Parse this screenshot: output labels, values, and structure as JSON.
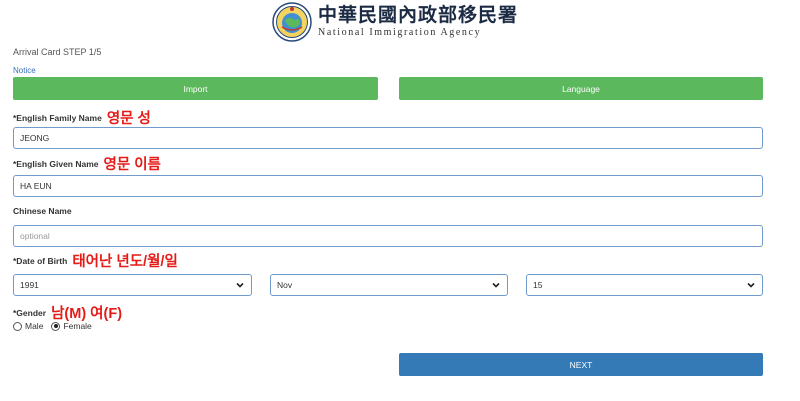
{
  "header": {
    "agency_cn": "中華民國內政部移民署",
    "agency_en": "National Immigration Agency"
  },
  "step_label": "Arrival Card STEP 1/5",
  "notice_link": "Notice",
  "buttons": {
    "import": "Import",
    "language": "Language",
    "next": "NEXT"
  },
  "fields": {
    "family_name": {
      "label": "*English Family Name",
      "annotation_ko": "영문 성",
      "value": "JEONG"
    },
    "given_name": {
      "label": "*English Given Name",
      "annotation_ko": "영문 이름",
      "value": "HA EUN"
    },
    "chinese_name": {
      "label": "Chinese Name",
      "placeholder": "optional",
      "value": ""
    },
    "dob": {
      "label": "*Date of Birth",
      "annotation_ko": "태어난 년도/월/일",
      "year": "1991",
      "month": "Nov",
      "day": "15"
    },
    "gender": {
      "label": "*Gender",
      "annotation_ko": "남(M) 여(F)",
      "options": [
        "Male",
        "Female"
      ],
      "selected": "Female"
    }
  },
  "colors": {
    "green": "#5cb85c",
    "blue": "#337ab7",
    "annotation_red": "#e41b17",
    "border": "#6f9bcd"
  }
}
